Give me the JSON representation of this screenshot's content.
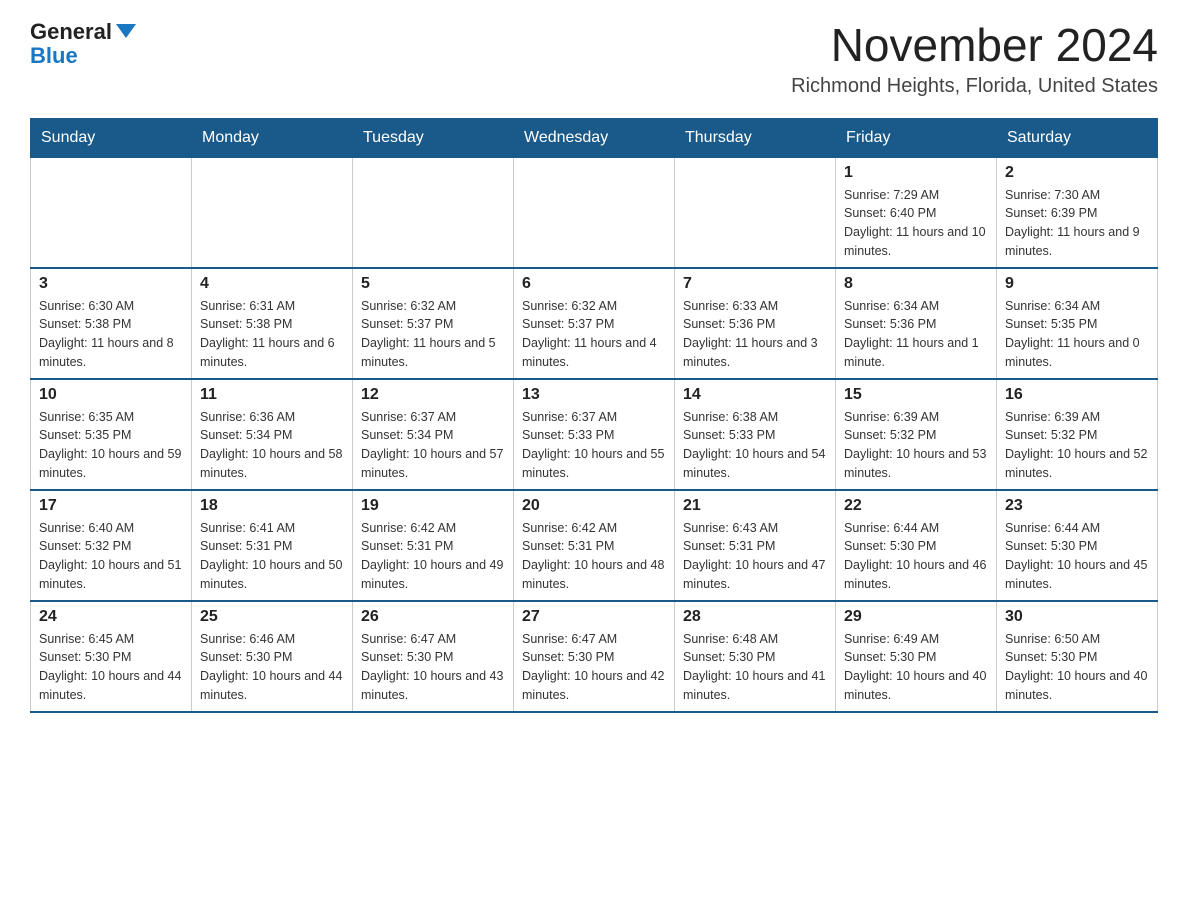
{
  "header": {
    "logo_general": "General",
    "logo_blue": "Blue",
    "title": "November 2024",
    "subtitle": "Richmond Heights, Florida, United States"
  },
  "calendar": {
    "days_of_week": [
      "Sunday",
      "Monday",
      "Tuesday",
      "Wednesday",
      "Thursday",
      "Friday",
      "Saturday"
    ],
    "weeks": [
      [
        {
          "day": "",
          "info": ""
        },
        {
          "day": "",
          "info": ""
        },
        {
          "day": "",
          "info": ""
        },
        {
          "day": "",
          "info": ""
        },
        {
          "day": "",
          "info": ""
        },
        {
          "day": "1",
          "info": "Sunrise: 7:29 AM\nSunset: 6:40 PM\nDaylight: 11 hours and 10 minutes."
        },
        {
          "day": "2",
          "info": "Sunrise: 7:30 AM\nSunset: 6:39 PM\nDaylight: 11 hours and 9 minutes."
        }
      ],
      [
        {
          "day": "3",
          "info": "Sunrise: 6:30 AM\nSunset: 5:38 PM\nDaylight: 11 hours and 8 minutes."
        },
        {
          "day": "4",
          "info": "Sunrise: 6:31 AM\nSunset: 5:38 PM\nDaylight: 11 hours and 6 minutes."
        },
        {
          "day": "5",
          "info": "Sunrise: 6:32 AM\nSunset: 5:37 PM\nDaylight: 11 hours and 5 minutes."
        },
        {
          "day": "6",
          "info": "Sunrise: 6:32 AM\nSunset: 5:37 PM\nDaylight: 11 hours and 4 minutes."
        },
        {
          "day": "7",
          "info": "Sunrise: 6:33 AM\nSunset: 5:36 PM\nDaylight: 11 hours and 3 minutes."
        },
        {
          "day": "8",
          "info": "Sunrise: 6:34 AM\nSunset: 5:36 PM\nDaylight: 11 hours and 1 minute."
        },
        {
          "day": "9",
          "info": "Sunrise: 6:34 AM\nSunset: 5:35 PM\nDaylight: 11 hours and 0 minutes."
        }
      ],
      [
        {
          "day": "10",
          "info": "Sunrise: 6:35 AM\nSunset: 5:35 PM\nDaylight: 10 hours and 59 minutes."
        },
        {
          "day": "11",
          "info": "Sunrise: 6:36 AM\nSunset: 5:34 PM\nDaylight: 10 hours and 58 minutes."
        },
        {
          "day": "12",
          "info": "Sunrise: 6:37 AM\nSunset: 5:34 PM\nDaylight: 10 hours and 57 minutes."
        },
        {
          "day": "13",
          "info": "Sunrise: 6:37 AM\nSunset: 5:33 PM\nDaylight: 10 hours and 55 minutes."
        },
        {
          "day": "14",
          "info": "Sunrise: 6:38 AM\nSunset: 5:33 PM\nDaylight: 10 hours and 54 minutes."
        },
        {
          "day": "15",
          "info": "Sunrise: 6:39 AM\nSunset: 5:32 PM\nDaylight: 10 hours and 53 minutes."
        },
        {
          "day": "16",
          "info": "Sunrise: 6:39 AM\nSunset: 5:32 PM\nDaylight: 10 hours and 52 minutes."
        }
      ],
      [
        {
          "day": "17",
          "info": "Sunrise: 6:40 AM\nSunset: 5:32 PM\nDaylight: 10 hours and 51 minutes."
        },
        {
          "day": "18",
          "info": "Sunrise: 6:41 AM\nSunset: 5:31 PM\nDaylight: 10 hours and 50 minutes."
        },
        {
          "day": "19",
          "info": "Sunrise: 6:42 AM\nSunset: 5:31 PM\nDaylight: 10 hours and 49 minutes."
        },
        {
          "day": "20",
          "info": "Sunrise: 6:42 AM\nSunset: 5:31 PM\nDaylight: 10 hours and 48 minutes."
        },
        {
          "day": "21",
          "info": "Sunrise: 6:43 AM\nSunset: 5:31 PM\nDaylight: 10 hours and 47 minutes."
        },
        {
          "day": "22",
          "info": "Sunrise: 6:44 AM\nSunset: 5:30 PM\nDaylight: 10 hours and 46 minutes."
        },
        {
          "day": "23",
          "info": "Sunrise: 6:44 AM\nSunset: 5:30 PM\nDaylight: 10 hours and 45 minutes."
        }
      ],
      [
        {
          "day": "24",
          "info": "Sunrise: 6:45 AM\nSunset: 5:30 PM\nDaylight: 10 hours and 44 minutes."
        },
        {
          "day": "25",
          "info": "Sunrise: 6:46 AM\nSunset: 5:30 PM\nDaylight: 10 hours and 44 minutes."
        },
        {
          "day": "26",
          "info": "Sunrise: 6:47 AM\nSunset: 5:30 PM\nDaylight: 10 hours and 43 minutes."
        },
        {
          "day": "27",
          "info": "Sunrise: 6:47 AM\nSunset: 5:30 PM\nDaylight: 10 hours and 42 minutes."
        },
        {
          "day": "28",
          "info": "Sunrise: 6:48 AM\nSunset: 5:30 PM\nDaylight: 10 hours and 41 minutes."
        },
        {
          "day": "29",
          "info": "Sunrise: 6:49 AM\nSunset: 5:30 PM\nDaylight: 10 hours and 40 minutes."
        },
        {
          "day": "30",
          "info": "Sunrise: 6:50 AM\nSunset: 5:30 PM\nDaylight: 10 hours and 40 minutes."
        }
      ]
    ]
  }
}
